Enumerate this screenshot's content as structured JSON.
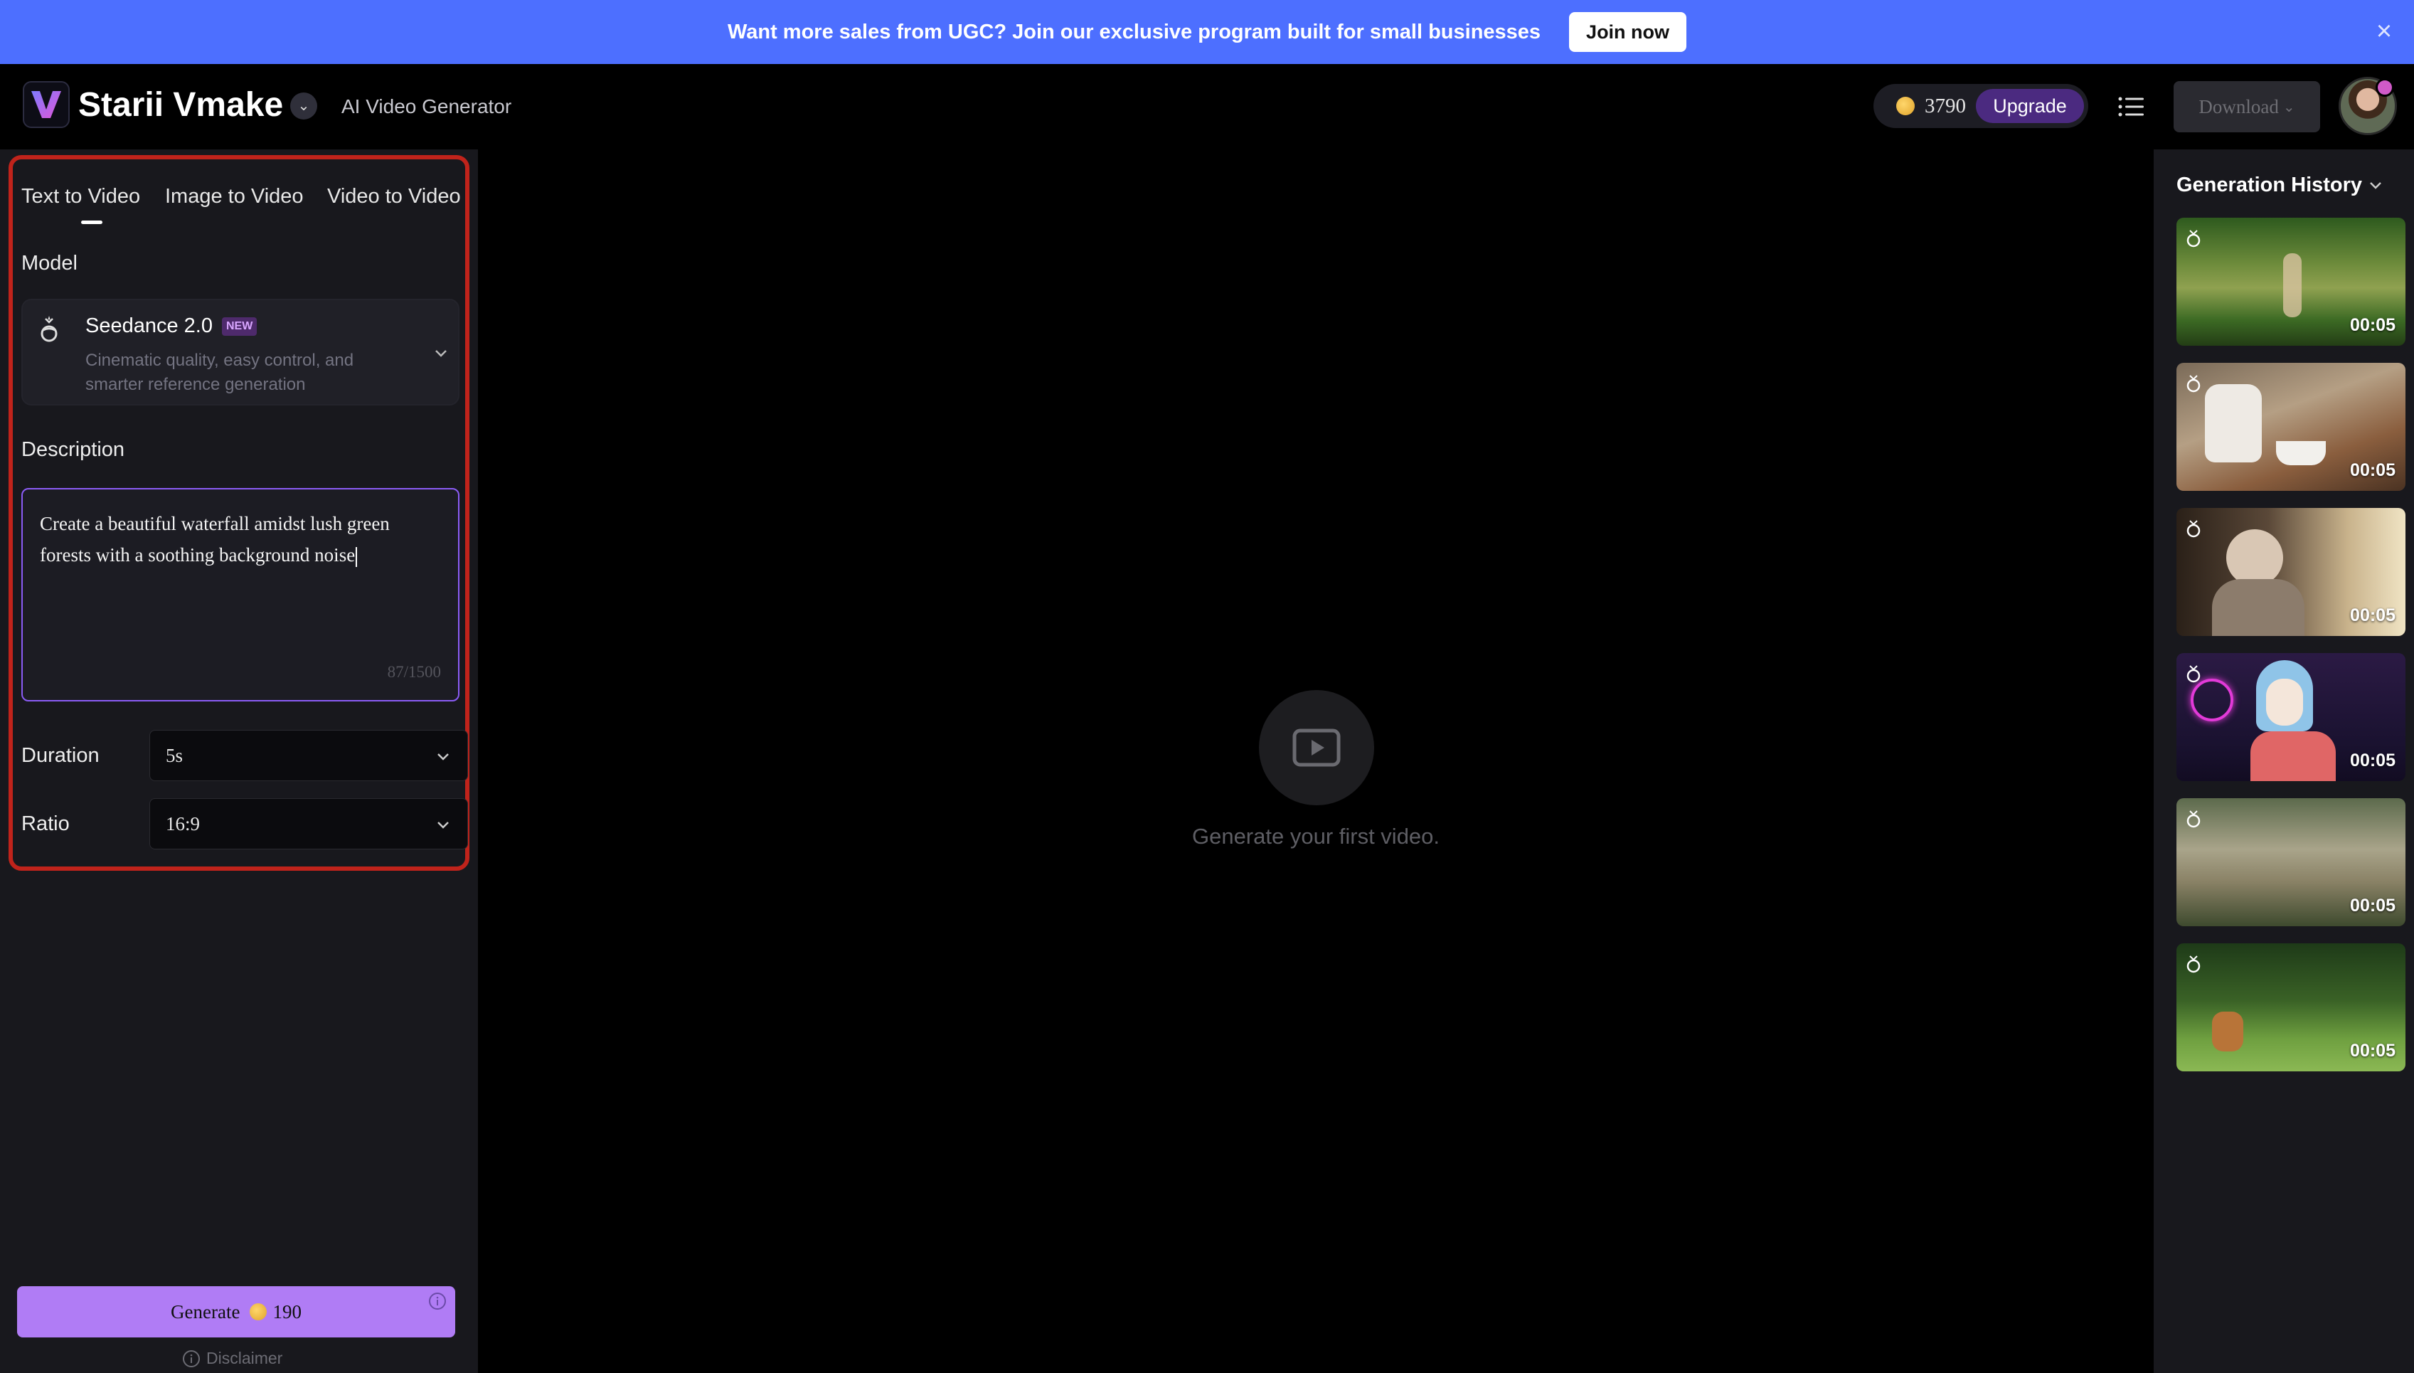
{
  "banner": {
    "text": "Want more sales from UGC? Join our exclusive program built for small businesses",
    "cta": "Join now",
    "close_icon": "close-icon"
  },
  "header": {
    "app_name": "Starii Vmake",
    "subtitle": "AI Video Generator",
    "credits": "3790",
    "upgrade": "Upgrade",
    "download": "Download"
  },
  "tabs": [
    {
      "label": "Text to Video",
      "active": true
    },
    {
      "label": "Image to Video",
      "active": false
    },
    {
      "label": "Video to Video",
      "active": false
    }
  ],
  "model": {
    "section_label": "Model",
    "name": "Seedance 2.0",
    "badge": "NEW",
    "description": "Cinematic quality, easy control, and smarter reference generation"
  },
  "description": {
    "section_label": "Description",
    "value": "Create a beautiful waterfall amidst lush green forests with a soothing background noise",
    "count": "87/1500"
  },
  "duration": {
    "label": "Duration",
    "value": "5s"
  },
  "ratio": {
    "label": "Ratio",
    "value": "16:9"
  },
  "generate": {
    "label": "Generate",
    "cost": "190"
  },
  "disclaimer": "Disclaimer",
  "center": {
    "empty_text": "Generate your first video."
  },
  "history": {
    "title": "Generation History",
    "items": [
      {
        "duration": "00:05",
        "scene": "forest-walk"
      },
      {
        "duration": "00:05",
        "scene": "pouring-tea"
      },
      {
        "duration": "00:05",
        "scene": "woman-by-window"
      },
      {
        "duration": "00:05",
        "scene": "cartoon-girl-neon"
      },
      {
        "duration": "00:05",
        "scene": "grass-field"
      },
      {
        "duration": "00:05",
        "scene": "cat-on-lawn"
      }
    ]
  },
  "colors": {
    "banner": "#4d6fff",
    "accent": "#b07cf5",
    "highlight_border": "#c0231b",
    "panel": "#18181d"
  }
}
